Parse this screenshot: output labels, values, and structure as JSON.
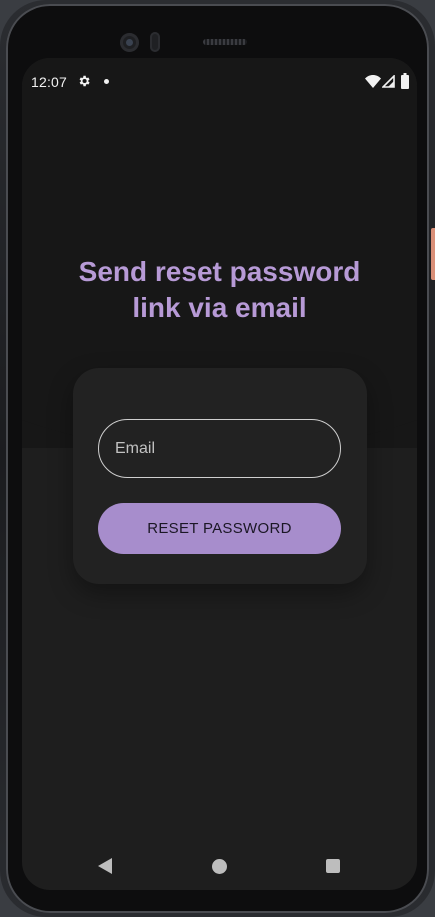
{
  "status_bar": {
    "time": "12:07",
    "icons": [
      "gear-icon",
      "dot-icon",
      "wifi-icon",
      "signal-icon",
      "battery-icon"
    ]
  },
  "page": {
    "title_line1": "Send reset password",
    "title_line2": "link via email"
  },
  "form": {
    "email_placeholder": "Email",
    "email_value": "",
    "reset_button_label": "RESET PASSWORD"
  },
  "nav_bar": {
    "icons": [
      "back-icon",
      "home-icon",
      "recents-icon"
    ]
  },
  "colors": {
    "accent": "#b79ad6",
    "button": "#a78dcc",
    "background": "#1e1e1e",
    "card": "#222222"
  }
}
